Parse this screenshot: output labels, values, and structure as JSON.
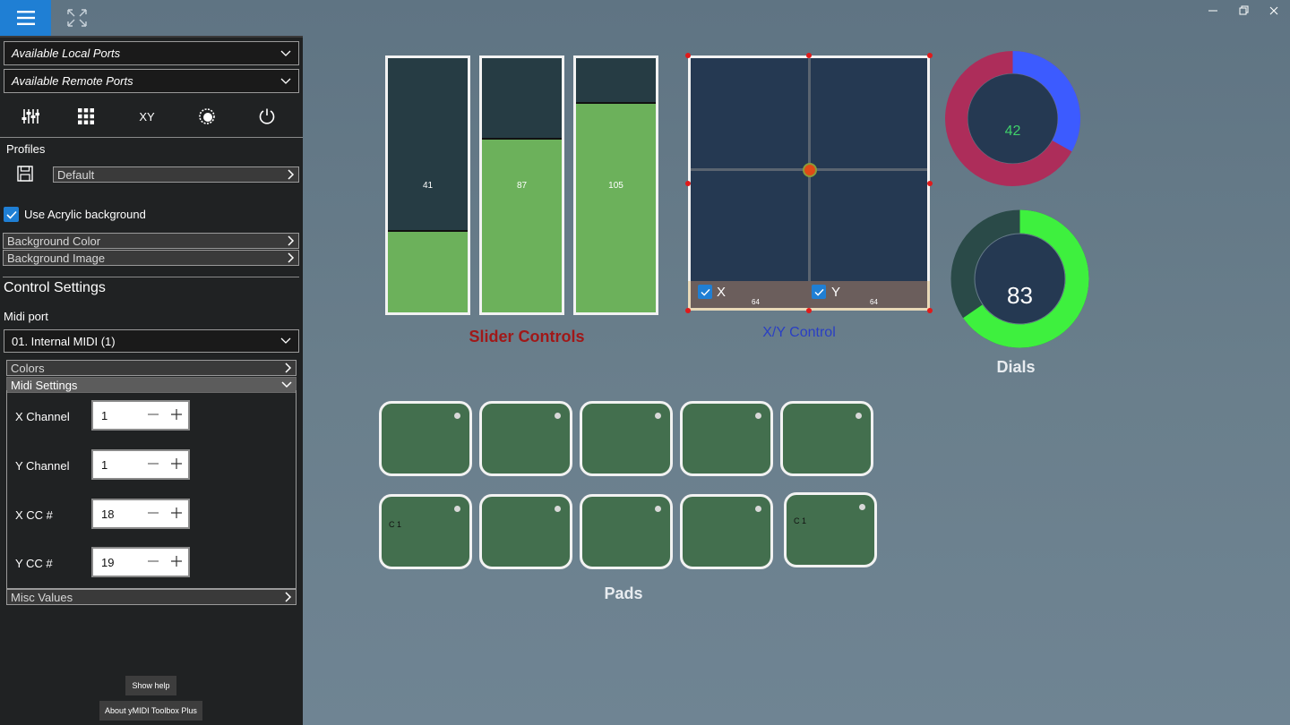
{
  "titlebar": {
    "menu_icon": "hamburger-icon",
    "expand_icon": "fullscreen-icon",
    "window_buttons": [
      "minimize-icon",
      "restore-icon",
      "close-icon"
    ]
  },
  "sidebar": {
    "local_ports": "Available Local Ports",
    "remote_ports": "Available Remote Ports",
    "tools": [
      {
        "icon": "sliders-icon"
      },
      {
        "icon": "grid-icon"
      },
      {
        "label": "XY"
      },
      {
        "icon": "dial-icon"
      },
      {
        "icon": "power-icon"
      }
    ],
    "profiles_label": "Profiles",
    "profile_value": "Default",
    "acrylic_label": "Use Acrylic background",
    "acrylic_checked": true,
    "bg_color_label": "Background Color",
    "bg_image_label": "Background Image",
    "control_settings_label": "Control Settings",
    "midi_port_label": "Midi port",
    "midi_port_value": "01. Internal MIDI (1)",
    "colors_label": "Colors",
    "midi_settings_label": "Midi Settings",
    "fields": [
      {
        "label": "X Channel",
        "value": "1"
      },
      {
        "label": "Y Channel",
        "value": "1"
      },
      {
        "label": "X CC #",
        "value": "18"
      },
      {
        "label": "Y CC #",
        "value": "19"
      }
    ],
    "misc_label": "Misc Values",
    "help_button": "Show help",
    "about_button": "About yMIDI Toolbox Plus"
  },
  "sliders": {
    "title": "Slider Controls",
    "title_color": "#a01818",
    "max": 127,
    "items": [
      {
        "value": "41",
        "level": 41
      },
      {
        "value": "87",
        "level": 87
      },
      {
        "value": "105",
        "level": 105
      }
    ]
  },
  "xy": {
    "title": "X/Y Control",
    "title_color": "#2a3fc4",
    "x_label": "X",
    "y_label": "Y",
    "x_value": "64",
    "y_value": "64",
    "x_checked": true,
    "y_checked": true
  },
  "dials": {
    "title": "Dials",
    "items": [
      {
        "value": "42",
        "level": 42,
        "fill_color": "#3c5bff",
        "track_color": "#ad2d5a",
        "value_color": "#3fd06a"
      },
      {
        "value": "83",
        "level": 83,
        "fill_color": "#3ef03e",
        "track_color": "#2a4a48",
        "value_color": "#ffffff"
      }
    ],
    "max": 127
  },
  "pads": {
    "title": "Pads",
    "row1": [
      {
        "note": ""
      },
      {
        "note": ""
      },
      {
        "note": ""
      },
      {
        "note": ""
      },
      {
        "note": ""
      }
    ],
    "row2": [
      {
        "note": "C  1"
      },
      {
        "note": ""
      },
      {
        "note": ""
      },
      {
        "note": ""
      },
      {
        "note": "C  1"
      }
    ]
  }
}
